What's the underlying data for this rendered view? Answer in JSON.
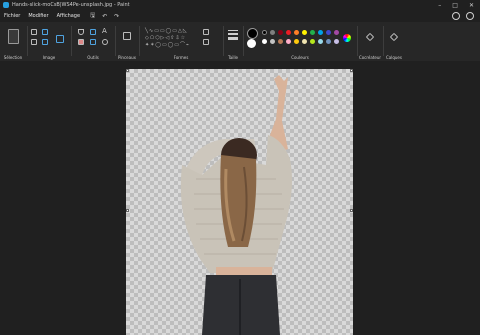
{
  "window": {
    "title": "Hands-slick-moCsB|WS4Pe-unsplash.jpg - Paint"
  },
  "menu": {
    "items": [
      "Fichier",
      "Modifier",
      "Affichage"
    ]
  },
  "ribbon": {
    "groups": [
      "Sélection",
      "Image",
      "Outils",
      "Pinceaux",
      "Formes",
      "Taille",
      "Couleurs",
      "Cocréateur",
      "Calques"
    ]
  },
  "palette": {
    "colors": [
      "#000000",
      "#7f7f7f",
      "#880015",
      "#ed1c24",
      "#ff7f27",
      "#fff200",
      "#22b14c",
      "#00a2e8",
      "#3f48cc",
      "#a349a4",
      "#ffffff",
      "#c3c3c3",
      "#b97a57",
      "#ffaec9",
      "#ffc90e",
      "#efe4b0",
      "#b5e61d",
      "#99d9ea",
      "#7092be",
      "#c8bfe7"
    ]
  },
  "accent": "#27a0e0"
}
